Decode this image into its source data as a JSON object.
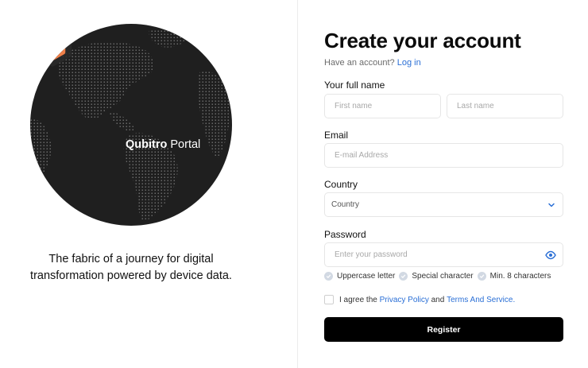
{
  "left": {
    "brand_bold": "Qubitro",
    "brand_light": "Portal",
    "tagline": "The fabric of a journey for digital transformation powered by device data."
  },
  "form": {
    "title": "Create your account",
    "have_account": "Have an account?",
    "login_link": "Log in",
    "name_label": "Your full name",
    "first_name_placeholder": "First name",
    "last_name_placeholder": "Last name",
    "email_label": "Email",
    "email_placeholder": "E-mail Address",
    "country_label": "Country",
    "country_selected": "Country",
    "password_label": "Password",
    "password_placeholder": "Enter your password",
    "requirements": [
      "Uppercase letter",
      "Special character",
      "Min. 8 characters"
    ],
    "agree_prefix": "I agree the",
    "privacy_link": "Privacy Policy",
    "agree_and": "and",
    "terms_link": "Terms And Service.",
    "register_label": "Register"
  },
  "colors": {
    "accent": "#2a6fd6",
    "logo_orange": "#f0804a",
    "button": "#000000"
  },
  "icons": {
    "country_dropdown": "chevron-down-icon",
    "password_visibility": "eye-icon",
    "requirement": "check-circle-icon"
  }
}
